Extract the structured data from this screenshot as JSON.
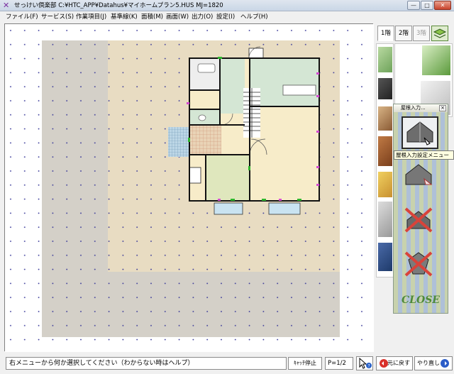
{
  "window": {
    "title": "せっけい倶楽部 C:¥HTC_APP¥Datahus¥マイホームプラン5.HUS  MJ=1820",
    "minimize": "—",
    "maximize": "□",
    "close": "✕"
  },
  "menu": [
    {
      "label": "ファイル(F)"
    },
    {
      "label": "サービス(S)"
    },
    {
      "label": "作業項目(J)"
    },
    {
      "label": "基準線(K)"
    },
    {
      "label": "面積(M)"
    },
    {
      "label": "画面(W)"
    },
    {
      "label": "出力(O)"
    },
    {
      "label": "設定(I)"
    },
    {
      "label": "ヘルプ(H)"
    }
  ],
  "floor_tabs": [
    {
      "label": "1階",
      "state": "active"
    },
    {
      "label": "2階",
      "state": "normal"
    },
    {
      "label": "3階",
      "state": "disabled"
    }
  ],
  "roof_popup": {
    "title": "屋根入力...",
    "close_x": "×",
    "close_label": "CLOSE"
  },
  "tooltip": "屋根入力設定メニュー",
  "plan": {
    "room_fill": "#f7ecc9",
    "wet_fill": "#d4e6d4",
    "japanese_fill": "#dfe7bd",
    "site_fill": "#e8dcc2",
    "yard_fill": "#d4d0c8"
  },
  "status": {
    "message": "右メニューから何か選択してください（わからない時はヘルプ）",
    "snap_label": "ｷｬｯﾁ停止",
    "page": "P=1/2",
    "undo_label": "元に戻す",
    "redo_label": "やり直し"
  }
}
